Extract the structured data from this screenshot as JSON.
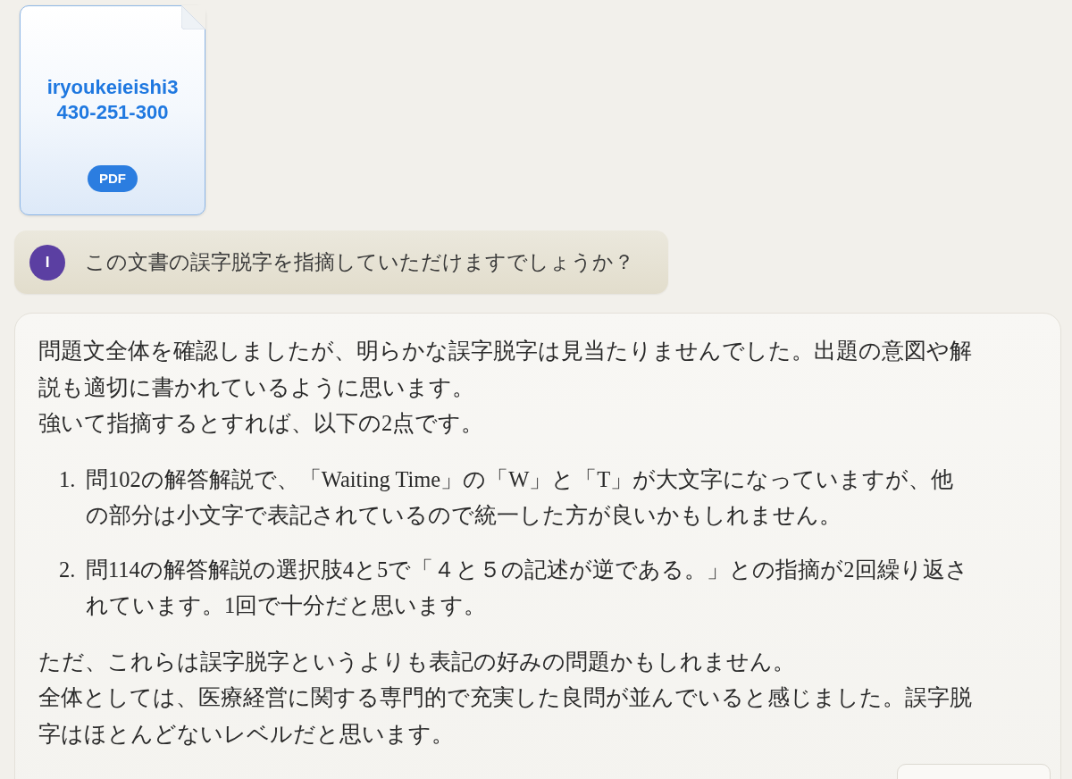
{
  "attachment": {
    "title_lines": [
      "iryoukeieishi3",
      "430-251-300"
    ],
    "badge": "PDF"
  },
  "user_message": {
    "avatar_initial": "I",
    "text": "この文書の誤字脱字を指摘していただけますでしょうか？"
  },
  "answer": {
    "blocks": [
      {
        "kind": "paragraph",
        "lines": [
          "問題文全体を確認しましたが、明らかな誤字脱字は見当たりませんでした。出題の意図や解説も適切に書かれているように思います。",
          "強いて指摘するとすれば、以下の2点です。"
        ]
      },
      {
        "kind": "list",
        "items": [
          {
            "marker": "1.",
            "text": "問102の解答解説で、「Waiting Time」の「W」と「T」が大文字になっていますが、他の部分は小文字で表記されているので統一した方が良いかもしれません。"
          },
          {
            "marker": "2.",
            "text": "問114の解答解説の選択肢4と5で「４と５の記述が逆である。」との指摘が2回繰り返されています。1回で十分だと思います。"
          }
        ]
      },
      {
        "kind": "paragraph",
        "lines": [
          "ただ、これらは誤字脱字というよりも表記の好みの問題かもしれません。",
          "全体としては、医療経営に関する専門的で充実した良問が並んでいると感じました。誤字脱字はほとんどないレベルだと思います。"
        ]
      }
    ]
  }
}
